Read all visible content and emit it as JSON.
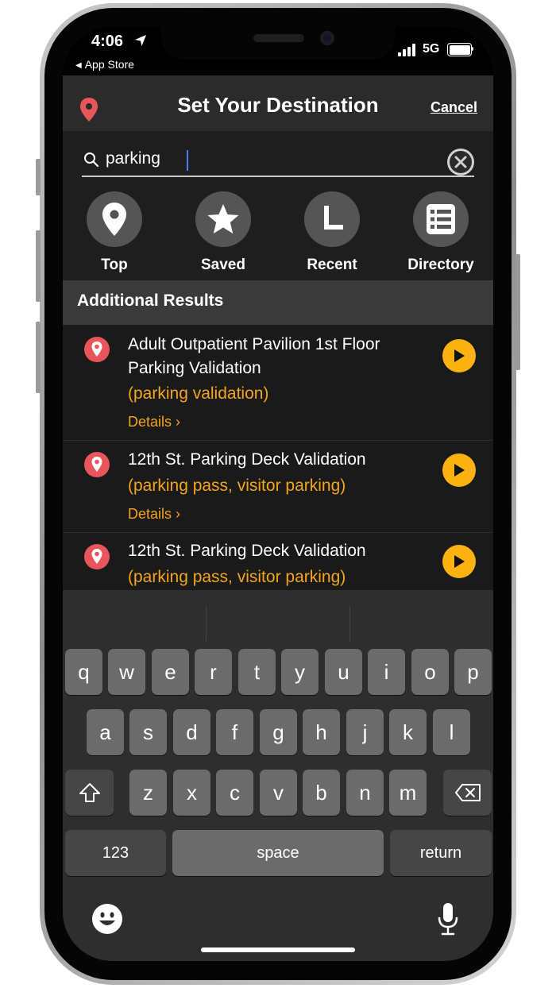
{
  "status_bar": {
    "time": "4:06",
    "back_app": "App Store",
    "network": "5G"
  },
  "header": {
    "title": "Set Your Destination",
    "cancel_label": "Cancel"
  },
  "search": {
    "value": "parking"
  },
  "quick_tabs": [
    {
      "label": "Top",
      "icon": "location-pin-icon"
    },
    {
      "label": "Saved",
      "icon": "star-icon"
    },
    {
      "label": "Recent",
      "icon": "clock-icon"
    },
    {
      "label": "Directory",
      "icon": "list-icon"
    }
  ],
  "section": {
    "title": "Additional Results"
  },
  "results": [
    {
      "title_line1": "Adult Outpatient Pavilion 1st Floor",
      "title_line2": "Parking Validation",
      "keywords": "(parking validation)",
      "details": "Details ›"
    },
    {
      "title_line1": "12th St. Parking Deck Validation",
      "keywords": "(parking pass, visitor parking)",
      "details": "Details ›"
    },
    {
      "title_line1": "12th St. Parking Deck Validation",
      "keywords": "(parking pass, visitor parking)"
    }
  ],
  "keyboard": {
    "row1": [
      "q",
      "w",
      "e",
      "r",
      "t",
      "y",
      "u",
      "i",
      "o",
      "p"
    ],
    "row2": [
      "a",
      "s",
      "d",
      "f",
      "g",
      "h",
      "j",
      "k",
      "l"
    ],
    "row3": [
      "z",
      "x",
      "c",
      "v",
      "b",
      "n",
      "m"
    ],
    "numbers_label": "123",
    "space_label": "space",
    "return_label": "return"
  },
  "colors": {
    "accent_orange": "#f5a51c",
    "go_button": "#fbb110",
    "pin_red": "#e8555a",
    "background": "#1a1a1a",
    "header": "#2b2b2b"
  }
}
